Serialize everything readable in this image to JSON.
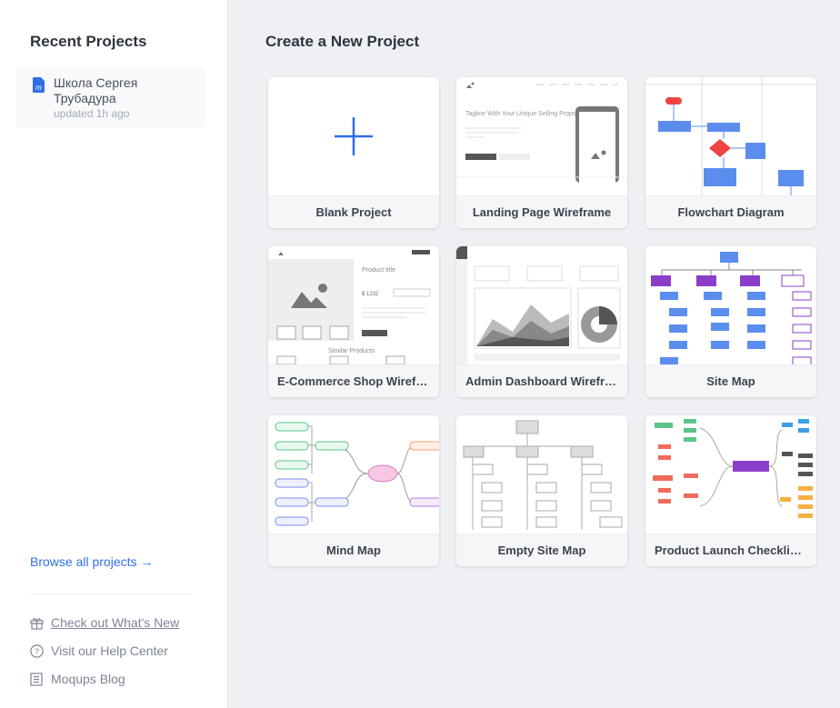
{
  "sidebar": {
    "title": "Recent Projects",
    "recent": [
      {
        "name": "Школа Сергея Трубадура",
        "updated": "updated 1h ago"
      }
    ],
    "browse": "Browse all projects →",
    "links": [
      {
        "label": "Check out What's New",
        "icon": "gift-icon"
      },
      {
        "label": "Visit our Help Center",
        "icon": "help-circle-icon"
      },
      {
        "label": "Moqups Blog",
        "icon": "blog-icon"
      }
    ]
  },
  "main": {
    "title": "Create a New Project",
    "templates": [
      {
        "label": "Blank Project"
      },
      {
        "label": "Landing Page Wireframe",
        "tagline": "Tagline With Your Unique Selling Proposition"
      },
      {
        "label": "Flowchart Diagram"
      },
      {
        "label": "E-Commerce Shop Wireframe",
        "product_title": "Product title",
        "price": "$ 1232",
        "similar": "Similar Products"
      },
      {
        "label": "Admin Dashboard Wireframe"
      },
      {
        "label": "Site Map"
      },
      {
        "label": "Mind Map"
      },
      {
        "label": "Empty Site Map"
      },
      {
        "label": "Product Launch Checklist Mind Map"
      }
    ]
  },
  "colors": {
    "accent": "#2f6fe8",
    "flow": "#5b8def",
    "purple": "#8b3fc9"
  }
}
